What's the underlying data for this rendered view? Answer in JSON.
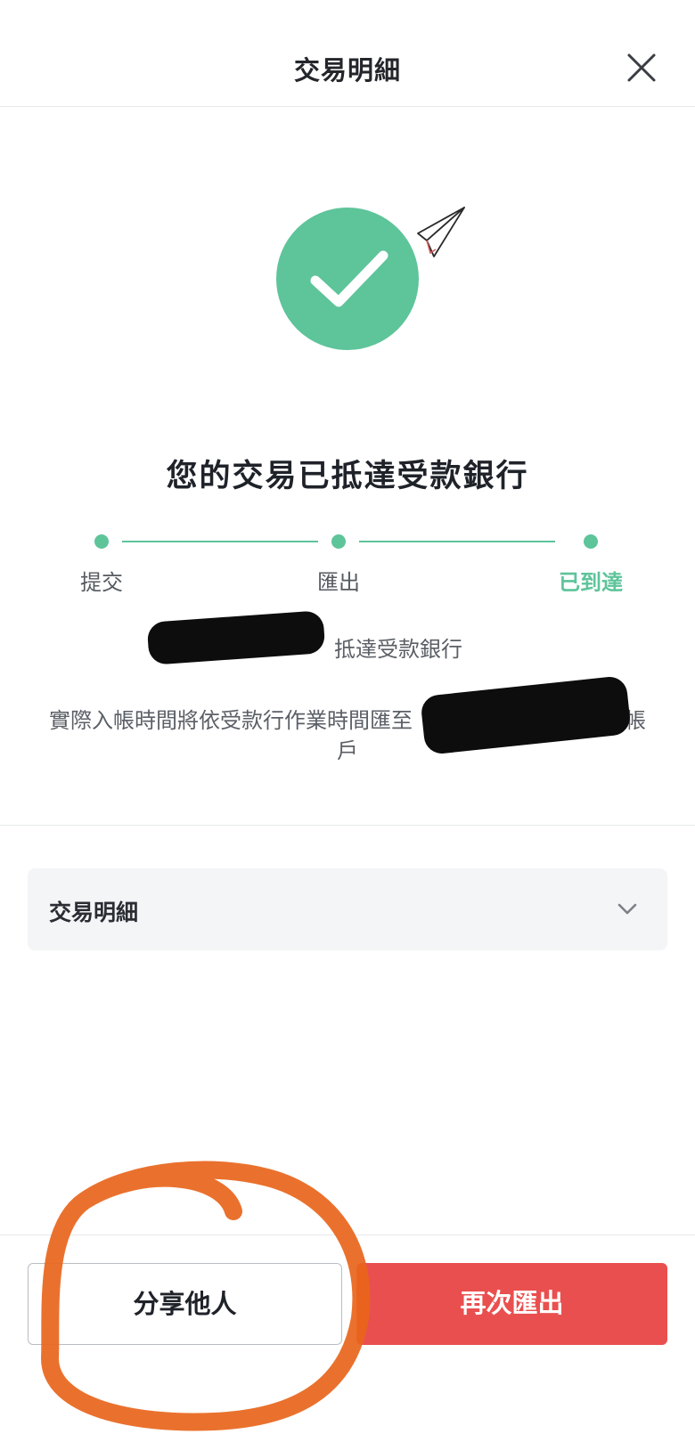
{
  "header": {
    "title": "交易明細"
  },
  "result": {
    "title": "您的交易已抵達受款銀行"
  },
  "steps": [
    {
      "label": "提交"
    },
    {
      "label": "匯出"
    },
    {
      "label": "已到達"
    }
  ],
  "description": {
    "line1_visible": "抵達受款銀行",
    "line2_visible": "實際入帳時間將依受款行作業時間匯至",
    "line2_end": "帳",
    "line3": "戶"
  },
  "details": {
    "label": "交易明細"
  },
  "footer": {
    "share_label": "分享他人",
    "again_label": "再次匯出"
  },
  "colors": {
    "accent": "#5ec49a",
    "primary_button": "#ea4f4f",
    "annotation": "#e8651b"
  }
}
